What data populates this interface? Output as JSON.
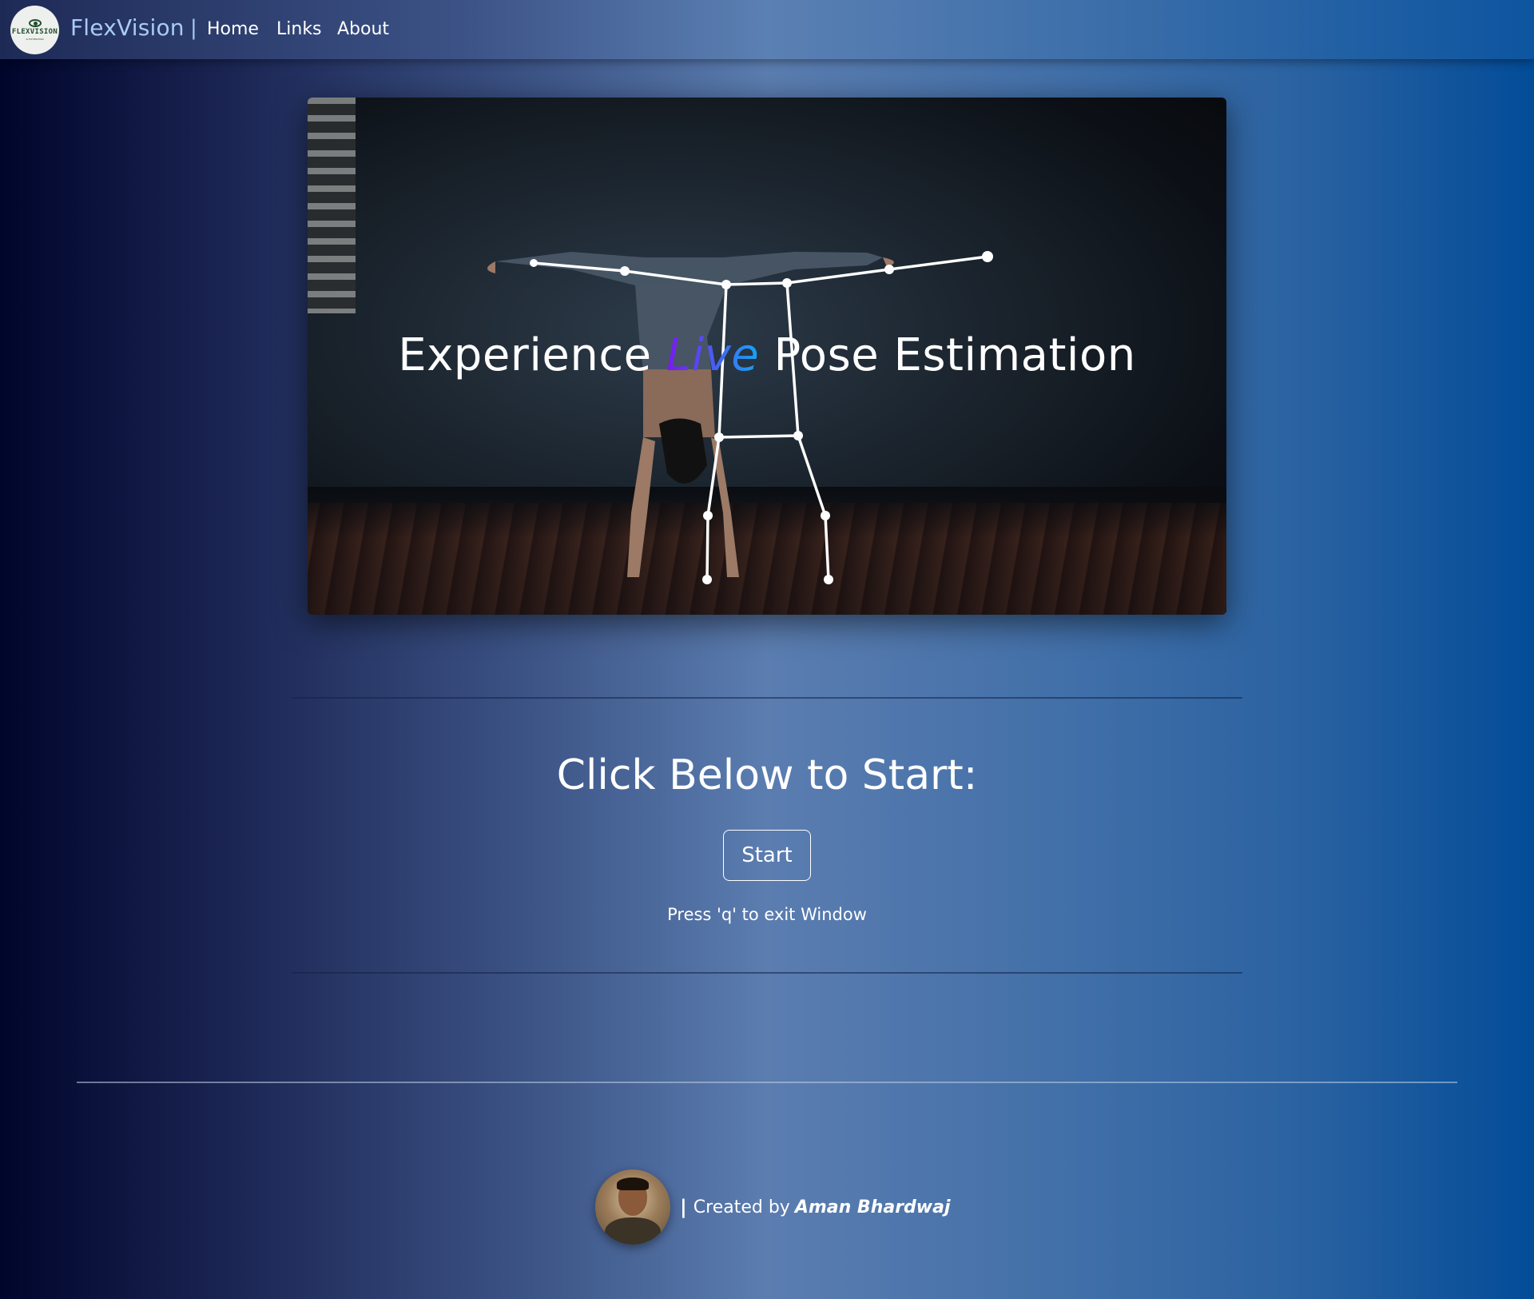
{
  "nav": {
    "logo": {
      "text": "FLEXVISION",
      "subtext": "AI ESTIMATION",
      "icon": "eye-icon"
    },
    "brand": "FlexVision",
    "separator": "|",
    "links": [
      "Home",
      "Links",
      "About"
    ]
  },
  "hero": {
    "title_before": "Experience ",
    "title_highlight": "Live",
    "title_after": " Pose Estimation",
    "highlight_colors": [
      "#7a18f0",
      "#4b5cf0",
      "#14a6f5"
    ]
  },
  "cta": {
    "title": "Click Below to Start:",
    "button_label": "Start",
    "hint": "Press 'q' to exit Window"
  },
  "footer": {
    "separator": "|",
    "created_by": "Created by",
    "author": "Aman Bhardwaj"
  },
  "colors": {
    "brand": "#a9cbf4",
    "skeleton": "#ffffff",
    "background_left": "#00052b",
    "background_right": "#034c98"
  }
}
